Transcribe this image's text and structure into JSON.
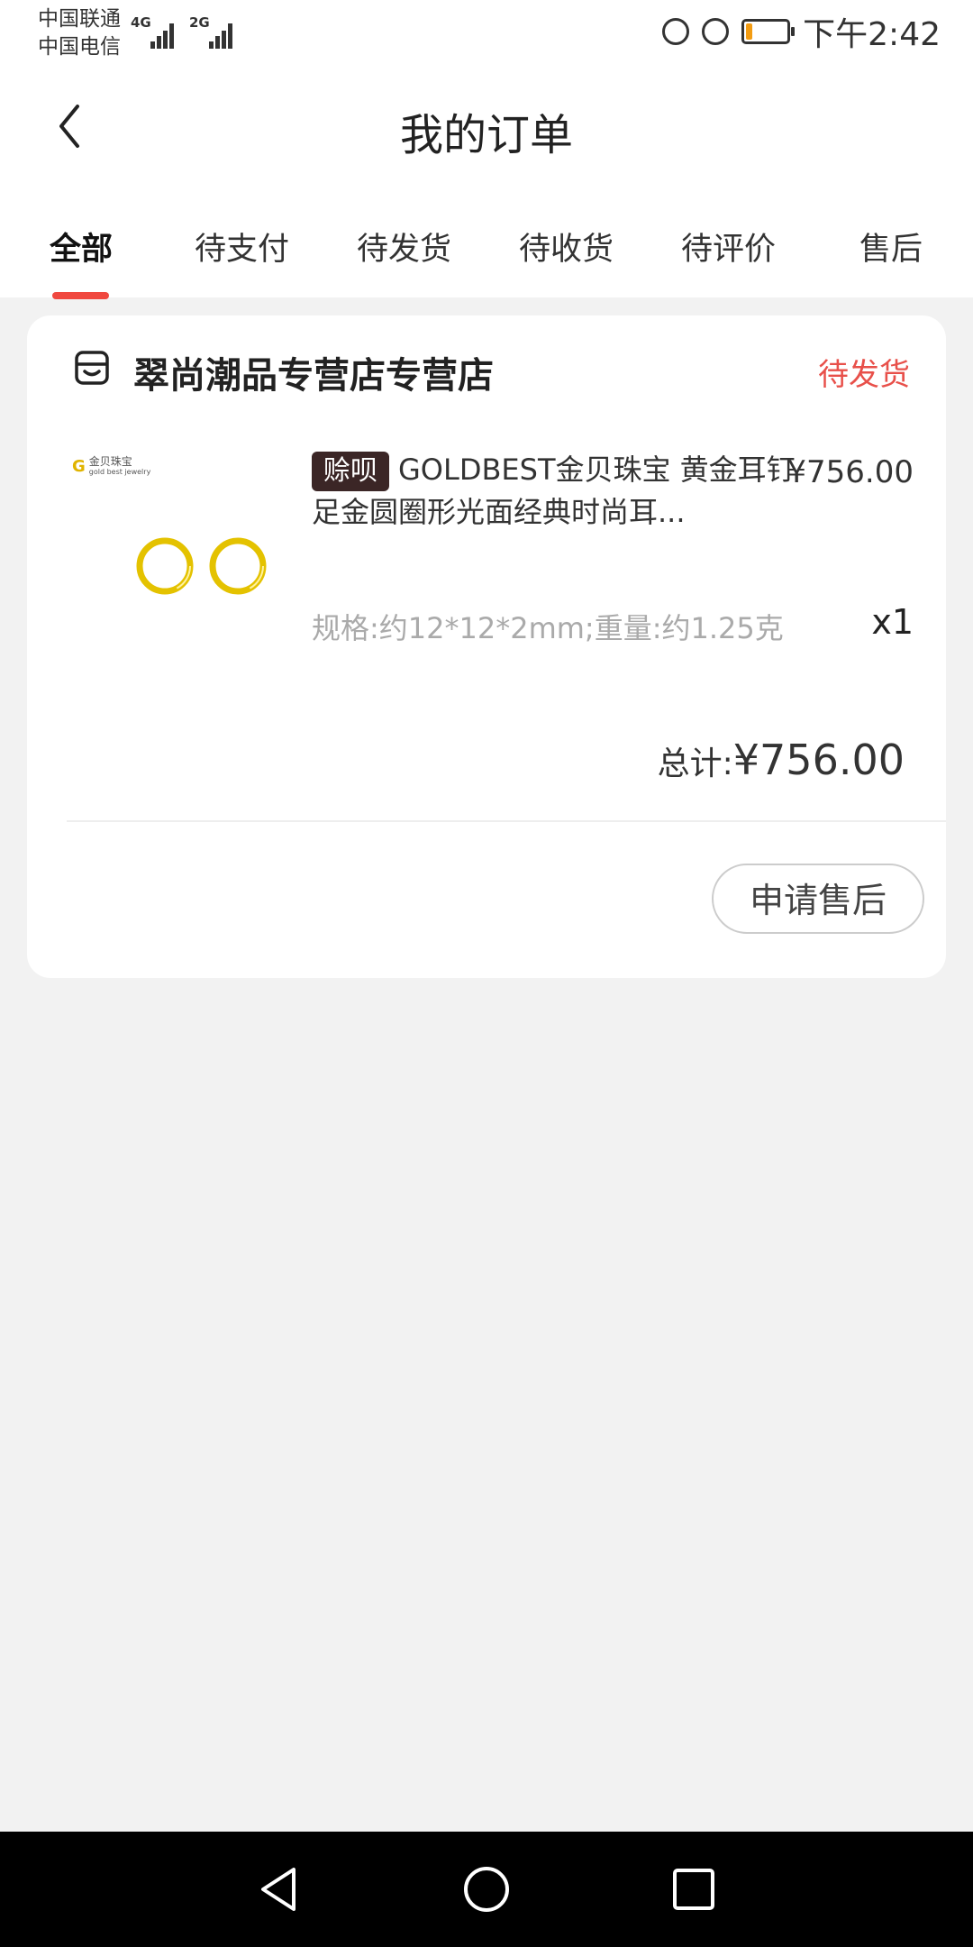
{
  "status_bar": {
    "carrier_1": "中国联通",
    "carrier_2": "中国电信",
    "sim1_network": "4G",
    "sim2_network": "2G",
    "time": "下午2:42",
    "icons": [
      "sync-icon",
      "alarm-icon",
      "battery-icon"
    ],
    "battery_level_fraction": 0.15
  },
  "header": {
    "title": "我的订单",
    "back_icon": "chevron-left-icon"
  },
  "tabs": {
    "items": [
      {
        "label": "全部",
        "active": true
      },
      {
        "label": "待支付",
        "active": false
      },
      {
        "label": "待发货",
        "active": false
      },
      {
        "label": "待收货",
        "active": false
      },
      {
        "label": "待评价",
        "active": false
      },
      {
        "label": "售后",
        "active": false
      }
    ],
    "active_color": "#f0483f"
  },
  "order": {
    "store_icon": "store-icon",
    "store_name": "翠尚潮品专营店专营店",
    "status": "待发货",
    "status_color": "#e8504a",
    "product": {
      "brand_logo_text": "金贝珠宝",
      "brand_logo_sub": "gold best jewelry",
      "badge": "赊呗",
      "title": "GOLDBEST金贝珠宝 黄金耳钉足金圆圈形光面经典时尚耳...",
      "price": "¥756.00",
      "spec": "规格:约12*12*2mm;重量:约1.25克",
      "quantity": "x1"
    },
    "total_label": "总计:",
    "total_amount": "¥756.00",
    "after_sale_button": "申请售后"
  },
  "nav_bar": {
    "icons": [
      "back-triangle-icon",
      "home-circle-icon",
      "recents-square-icon"
    ]
  }
}
